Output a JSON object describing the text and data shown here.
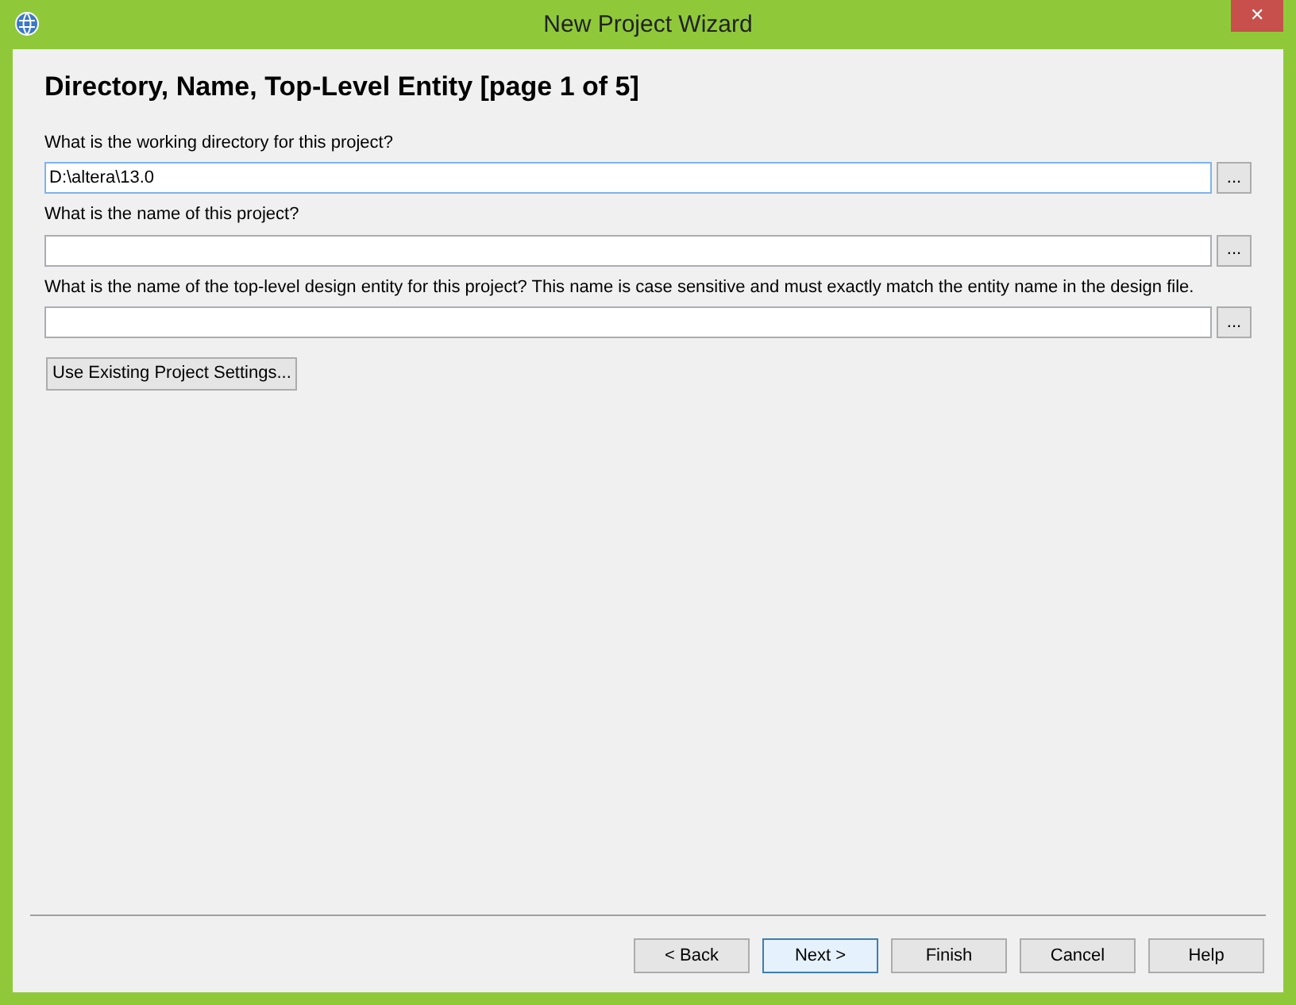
{
  "window": {
    "title": "New Project Wizard",
    "close": "✕"
  },
  "heading": "Directory, Name, Top-Level Entity [page 1 of 5]",
  "fields": [
    {
      "label": "What is the working directory for this project?",
      "value": "D:\\altera\\13.0",
      "focused": true,
      "browse": "..."
    },
    {
      "label": "What is the name of this project?",
      "focused": false,
      "browse": "..."
    },
    {
      "label": "What is the name of the top-level design entity for this project? This name is case sensitive and must exactly match the entity name in the design file.",
      "focused": false,
      "browse": "..."
    }
  ],
  "settings_button": "Use Existing Project Settings...",
  "buttons": [
    {
      "label": "< Back",
      "default": false
    },
    {
      "label": "Next >",
      "default": true
    },
    {
      "label": "Finish",
      "default": false
    },
    {
      "label": "Cancel",
      "default": false
    },
    {
      "label": "Help",
      "default": false
    }
  ]
}
